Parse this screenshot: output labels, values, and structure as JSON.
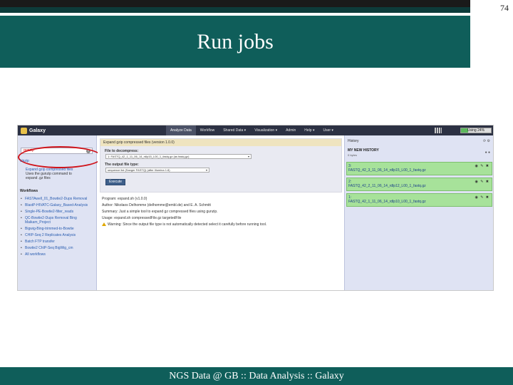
{
  "slide": {
    "number": "74",
    "title": "Run jobs",
    "footer": "NGS Data @ GB :: Data Analysis :: Galaxy"
  },
  "galaxy": {
    "brand": "Galaxy",
    "nav_tabs": [
      "Analyze Data",
      "Workflow",
      "Shared Data ▾",
      "Visualization ▾",
      "Admin",
      "Help ▾",
      "User ▾"
    ],
    "active_tab": "Analyze Data",
    "usage_label": "Using 24%",
    "usage_fraction": 0.24,
    "colors": {
      "masthead": "#2c3143",
      "panel": "#dfe3f3",
      "dataset_ok": "#a7e29a",
      "highlight_circle": "#d0141b"
    },
    "tool_panel": {
      "search_value": "gunzip",
      "unzip_link": "Unzip",
      "tool_link": "Expand gzip compressed files",
      "tool_description_1": "Uses the gunzip command to",
      "tool_description_2": "expand .gz files",
      "workflows_heading": "Workflows",
      "workflows": [
        "FASTAwell_01_Bowtie2-Dups Removal",
        "BlastP-HIVATC-Galaxy_Based-Analysis",
        "Single-PE-Bowtie2-filter_reads",
        "QC-Bowtie2-Dups Removal Bing Maikam_Project",
        "Bigwig-Bing-trimmed-to-Bowtie",
        "CHIP-Seq 2 Replicates Analysis",
        "Batch FTP transfer",
        "Bowtie2 ChIP-Seq BigWig_cm",
        "All workflows"
      ]
    },
    "tool_form": {
      "title": "Expand gzip compressed files (version 1.0.0)",
      "file_label": "File to decompress:",
      "file_value": "1: FASTQ_42_1_11_06_14_rdlp15_L00_1_fastq.gz (as fastq.gz)",
      "type_label": "The output file type:",
      "type_value": "sequence list (Sanger FASTQ) (after Illumina 1.8)",
      "execute_label": "Execute",
      "program": "Program: expand.sh (v1.0.0)",
      "author": "Author: Nikolaos Delhomme (delhomme@embl.de) and E. A. Schmitt",
      "summary": "Summary: Just a simple tool to expand gz compressed files using gunzip.",
      "usage": "Usage: expand.sh compressedFile.gz targetedFile",
      "warning": "Warning: Since the output file type is not automatically detected select it carefully before running tool."
    },
    "history": {
      "heading": "History",
      "name": "MY NEW HISTORY",
      "size": "0 bytes",
      "datasets": [
        {
          "id": "3:",
          "name": "FASTQ_42_3_11_06_14_rdlp15_L00_1_fastq.gz"
        },
        {
          "id": "2:",
          "name": "FASTQ_42_2_11_06_14_rdlp12_L00_1_fastq.gz"
        },
        {
          "id": "1:",
          "name": "FASTQ_42_1_11_06_14_rdlp10_L00_1_fastq.gz"
        }
      ]
    }
  }
}
